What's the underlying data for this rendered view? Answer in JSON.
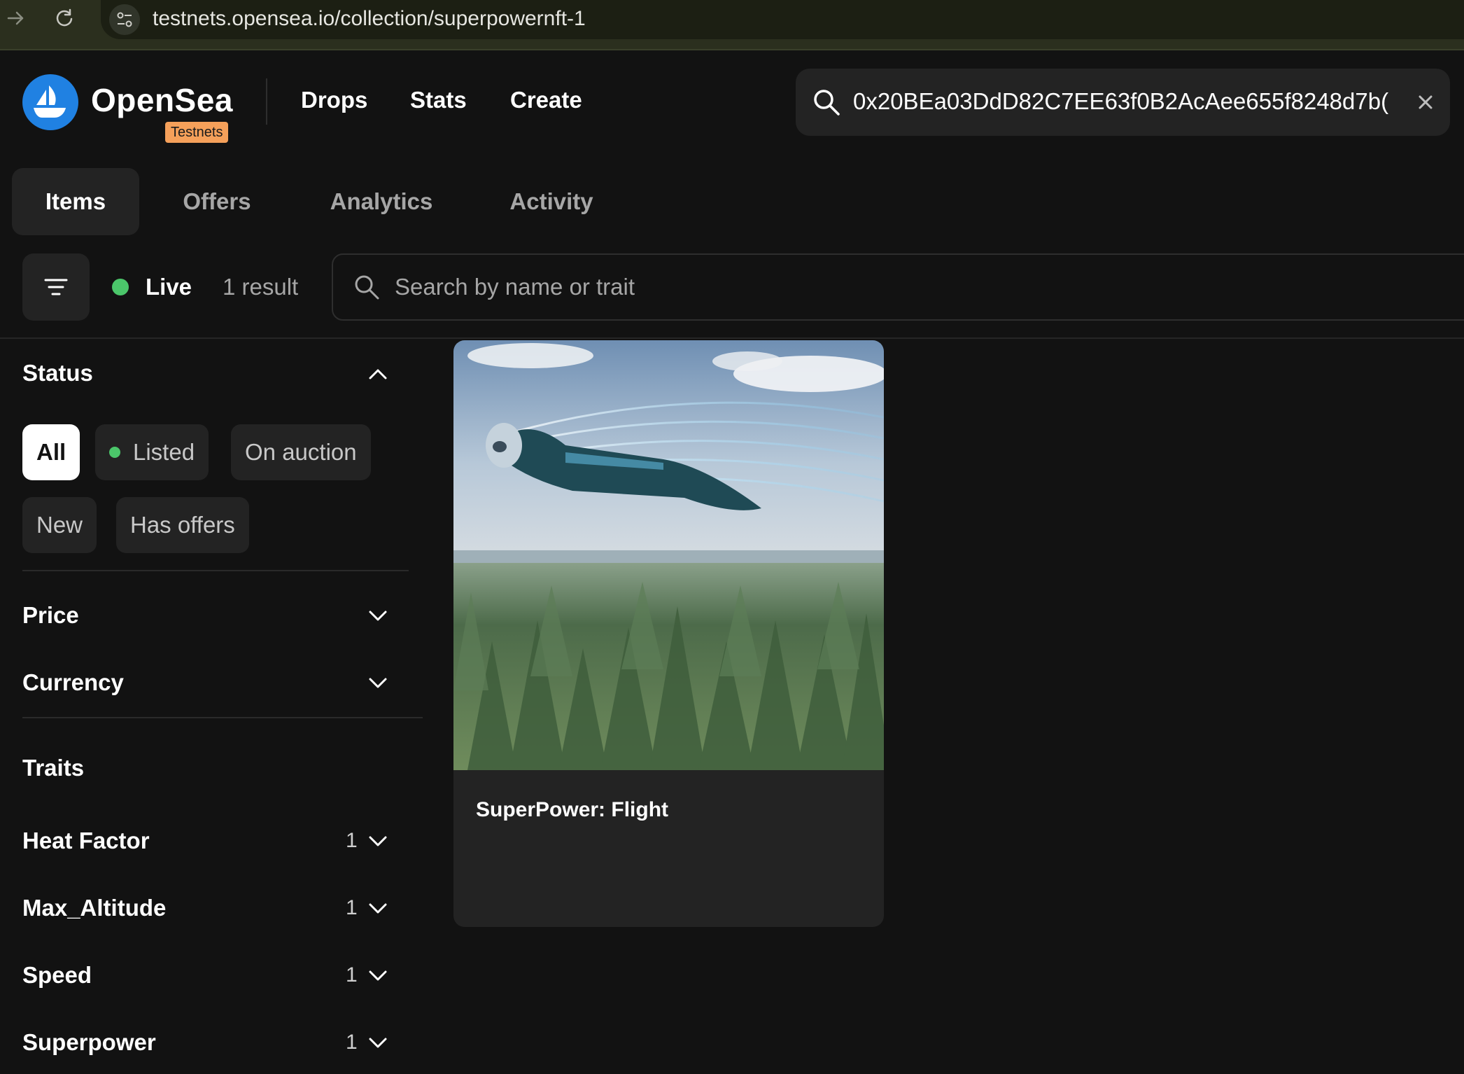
{
  "browser": {
    "url": "testnets.opensea.io/collection/superpowernft-1",
    "icons": [
      "forward-arrow-icon",
      "reload-icon",
      "site-settings-icon"
    ]
  },
  "header": {
    "logo_text": "OpenSea",
    "badge": "Testnets",
    "nav": [
      "Drops",
      "Stats",
      "Create"
    ],
    "search_value": "0x20BEa03DdD82C7EE63f0B2AcAee655f8248d7b("
  },
  "tabs": [
    "Items",
    "Offers",
    "Analytics",
    "Activity"
  ],
  "toolbar": {
    "live_label": "Live",
    "result_count": "1 result",
    "search_placeholder": "Search by name or trait"
  },
  "sidebar": {
    "status_title": "Status",
    "status_options": [
      "All",
      "Listed",
      "On auction",
      "New",
      "Has offers"
    ],
    "price_title": "Price",
    "currency_title": "Currency",
    "traits_title": "Traits",
    "traits": [
      {
        "name": "Heat Factor",
        "count": "1"
      },
      {
        "name": "Max_Altitude",
        "count": "1"
      },
      {
        "name": "Speed",
        "count": "1"
      },
      {
        "name": "Superpower",
        "count": "1"
      }
    ]
  },
  "items": [
    {
      "title": "SuperPower: Flight"
    }
  ],
  "colors": {
    "background": "#121212",
    "surface": "#232323",
    "accent_blue": "#2081e2",
    "live_green": "#4bc66a",
    "badge_orange": "#f5a05a"
  }
}
